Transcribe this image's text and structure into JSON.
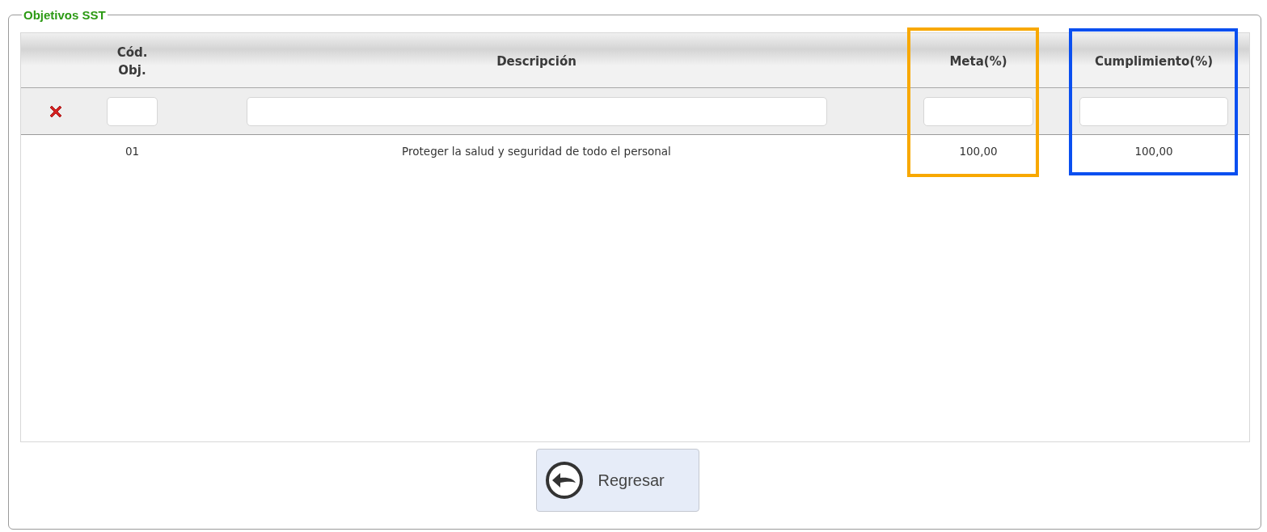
{
  "panel": {
    "title": "Objetivos SST"
  },
  "table": {
    "columns": [
      {
        "label": "Cód. Obj."
      },
      {
        "label": "Descripción"
      },
      {
        "label": "Meta(%)",
        "color": "#f8a800"
      },
      {
        "label": "Cumplimiento(%)",
        "color": "#0a4ff0"
      }
    ],
    "rows": [
      {
        "cells": [
          "01",
          "Proteger la salud y seguridad de todo el personal",
          "100,00",
          "100,00"
        ]
      }
    ]
  },
  "back_button": {
    "label": "Regresar"
  }
}
